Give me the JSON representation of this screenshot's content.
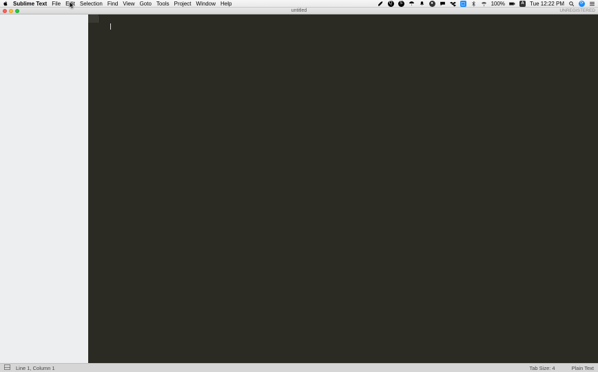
{
  "menubar": {
    "app_name": "Sublime Text",
    "items": [
      "File",
      "Edit",
      "Selection",
      "Find",
      "View",
      "Goto",
      "Tools",
      "Project",
      "Window",
      "Help"
    ],
    "battery": "100%",
    "clock": "Tue 12:22 PM"
  },
  "titlebar": {
    "title": "untitled",
    "right": "UNREGISTERED"
  },
  "tabs": [
    {
      "label": ""
    }
  ],
  "statusbar": {
    "position": "Line 1, Column 1",
    "tab_size": "Tab Size: 4",
    "syntax": "Plain Text"
  }
}
